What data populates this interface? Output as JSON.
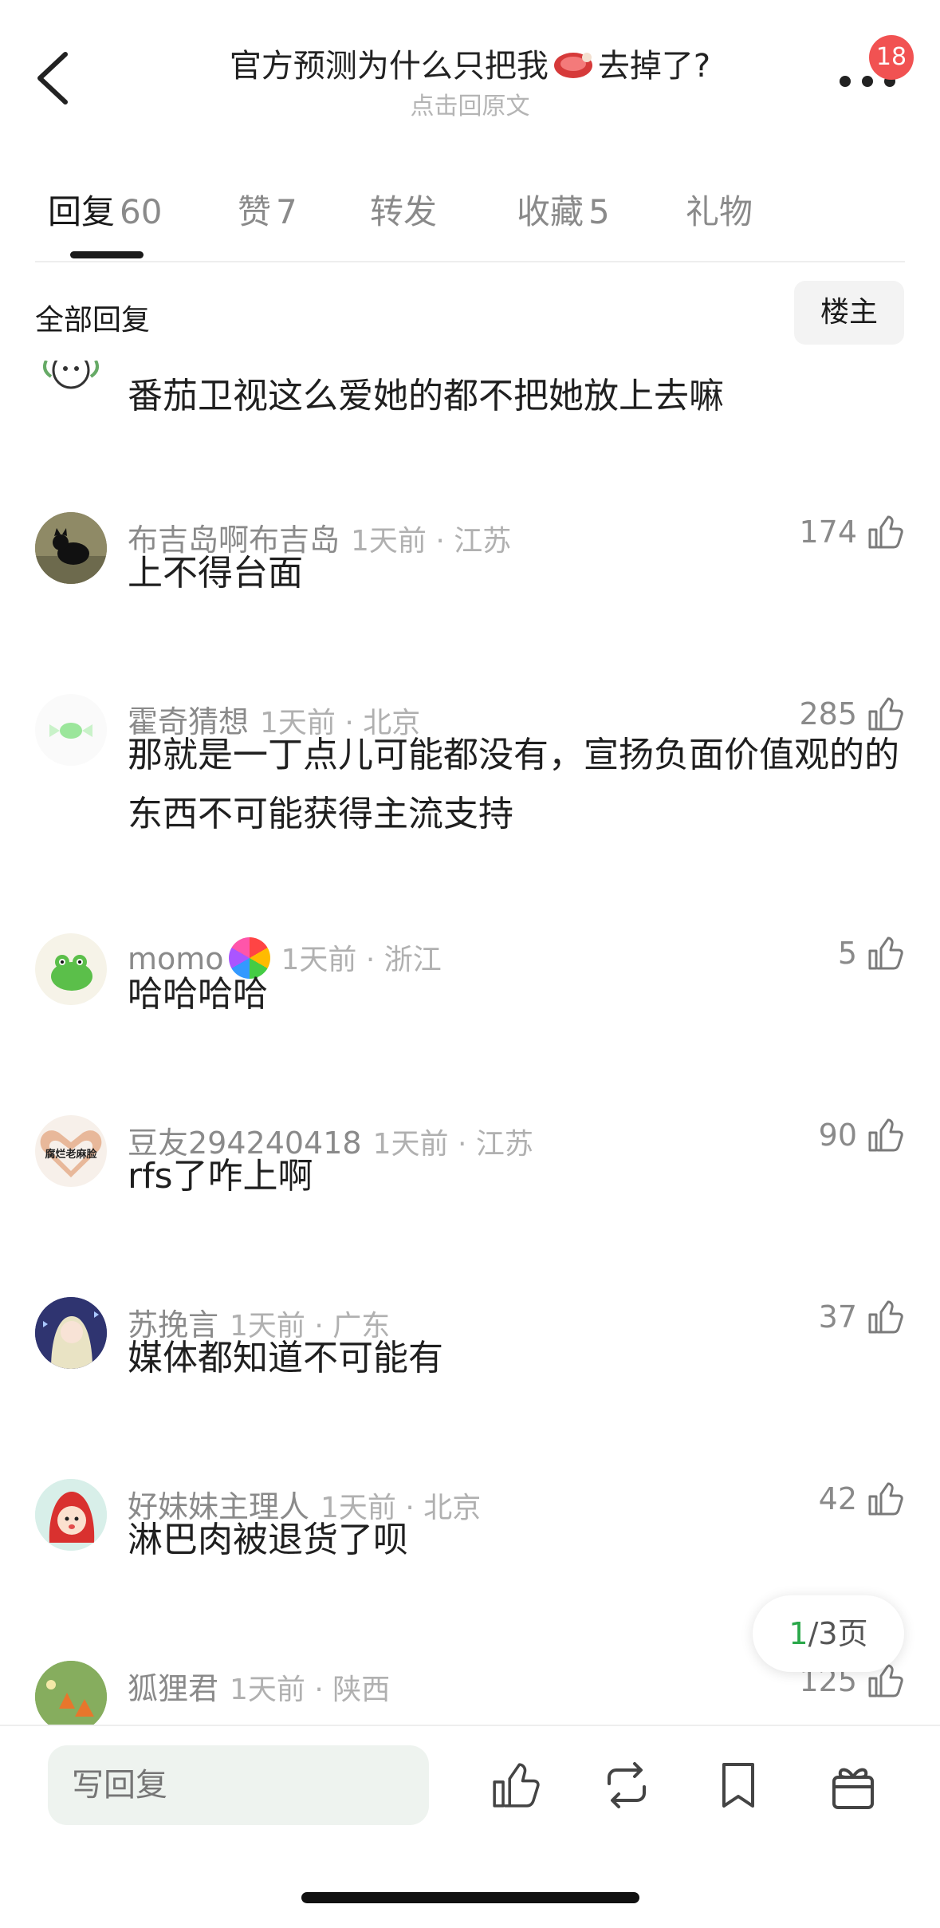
{
  "header": {
    "title_before": "官方预测为什么只把我",
    "title_after": "去掉了?",
    "subtitle": "点击回原文",
    "badge_count": "18"
  },
  "tabs": [
    {
      "label": "回复",
      "count": "60",
      "active": true
    },
    {
      "label": "赞",
      "count": "7"
    },
    {
      "label": "转发",
      "count": ""
    },
    {
      "label": "收藏",
      "count": "5"
    },
    {
      "label": "礼物",
      "count": ""
    }
  ],
  "filter": {
    "label": "全部回复",
    "owner_button": "楼主"
  },
  "comments": [
    {
      "name": "",
      "time": "",
      "likes": "",
      "text": "番茄卫视这么爱她的都不把她放上去嘛",
      "avatar_icon": "cartoon-face"
    },
    {
      "name": "布吉岛啊布吉岛",
      "time": "1天前 · 江苏",
      "likes": "174",
      "text": "上不得台面",
      "avatar_icon": "black-cat-photo"
    },
    {
      "name": "霍奇猜想",
      "time": "1天前 · 北京",
      "likes": "285",
      "text": "那就是一丁点儿可能都没有，宣扬负面价值观的的东西不可能获得主流支持",
      "avatar_icon": "green-candy"
    },
    {
      "name": "momo",
      "time": "1天前 · 浙江",
      "likes": "5",
      "text": "哈哈哈哈",
      "avatar_icon": "green-frog-sticker",
      "medal_icon": "rainbow-medal-icon"
    },
    {
      "name": "豆友294240418",
      "time": "1天前 · 江苏",
      "likes": "90",
      "text": "rfs了咋上啊",
      "avatar_icon": "heart-hands-sticker",
      "avatar_text": "腐烂老麻脸"
    },
    {
      "name": "苏挽言",
      "time": "1天前 · 广东",
      "likes": "37",
      "text": "媒体都知道不可能有",
      "avatar_icon": "anime-girl"
    },
    {
      "name": "好妹妹主理人",
      "time": "1天前 · 北京",
      "likes": "42",
      "text": "淋巴肉被退货了呗",
      "avatar_icon": "red-hood-baby"
    },
    {
      "name": "狐狸君",
      "time": "1天前 · 陕西",
      "likes": "125",
      "text": "",
      "avatar_icon": "fox-illustration"
    }
  ],
  "pager": {
    "current": "1",
    "total": "/3页"
  },
  "bottom_bar": {
    "reply_placeholder": "写回复"
  },
  "colors": {
    "accent_green": "#2aa84a",
    "badge_red": "#f15252",
    "input_bg": "#eef3ef"
  }
}
